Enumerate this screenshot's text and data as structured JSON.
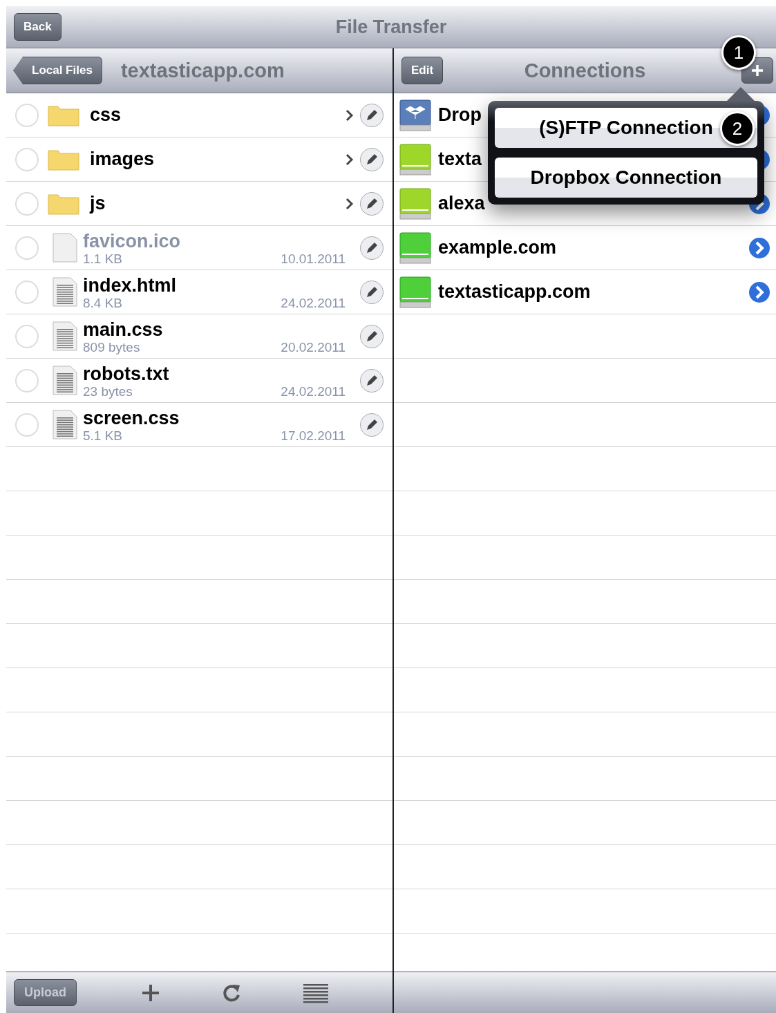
{
  "window": {
    "title": "File Transfer",
    "back_button": "Back"
  },
  "local_pane": {
    "back_button": "Local Files",
    "title": "textasticapp.com",
    "items": [
      {
        "kind": "folder",
        "name": "css",
        "disabled": false
      },
      {
        "kind": "folder",
        "name": "images",
        "disabled": false
      },
      {
        "kind": "folder",
        "name": "js",
        "disabled": false
      },
      {
        "kind": "blank",
        "name": "favicon.ico",
        "size": "1.1 KB",
        "date": "10.01.2011",
        "disabled": true
      },
      {
        "kind": "text",
        "name": "index.html",
        "size": "8.4 KB",
        "date": "24.02.2011",
        "disabled": false
      },
      {
        "kind": "text",
        "name": "main.css",
        "size": "809 bytes",
        "date": "20.02.2011",
        "disabled": false
      },
      {
        "kind": "text",
        "name": "robots.txt",
        "size": "23 bytes",
        "date": "24.02.2011",
        "disabled": false
      },
      {
        "kind": "text",
        "name": "screen.css",
        "size": "5.1 KB",
        "date": "17.02.2011",
        "disabled": false
      }
    ],
    "toolbar": {
      "upload_button": "Upload"
    }
  },
  "connections_pane": {
    "edit_button": "Edit",
    "title": "Connections",
    "items": [
      {
        "kind": "dropbox",
        "name": "Drop"
      },
      {
        "kind": "ftp",
        "name": "texta"
      },
      {
        "kind": "ftp",
        "name": "alexa"
      },
      {
        "kind": "sftp",
        "name": "example.com"
      },
      {
        "kind": "sftp",
        "name": "textasticapp.com"
      }
    ],
    "popover": {
      "options": [
        "(S)FTP Connection",
        "Dropbox Connection"
      ]
    }
  },
  "callouts": [
    "1",
    "2"
  ]
}
